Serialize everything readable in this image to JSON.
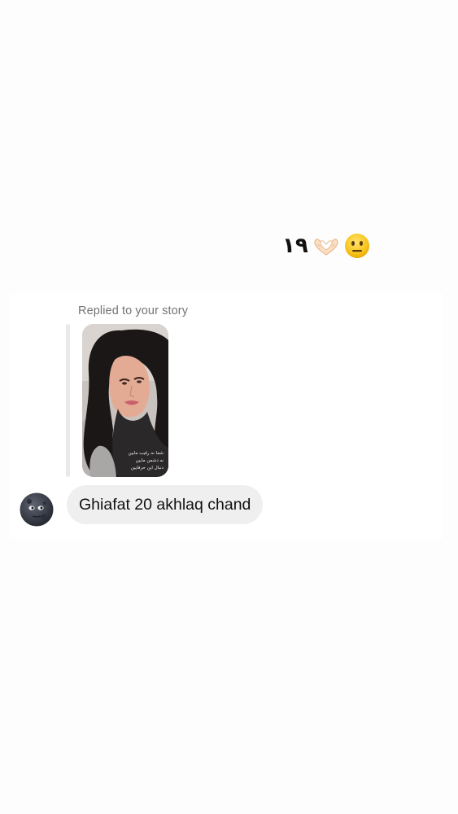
{
  "story_caption": {
    "number": "۱۹",
    "hands_emoji": "heart-hands-icon",
    "face_emoji": "neutral-face-icon"
  },
  "thread": {
    "reply_label": "Replied to your story",
    "story_thumbnail": {
      "overlay_lines": [
        "شما نه رقیب مایین",
        "نه دشمن مایین",
        "دنبال این حرفایین"
      ]
    },
    "sender_avatar": "new-moon-face-icon",
    "message": "Ghiafat 20 akhlaq chand"
  }
}
